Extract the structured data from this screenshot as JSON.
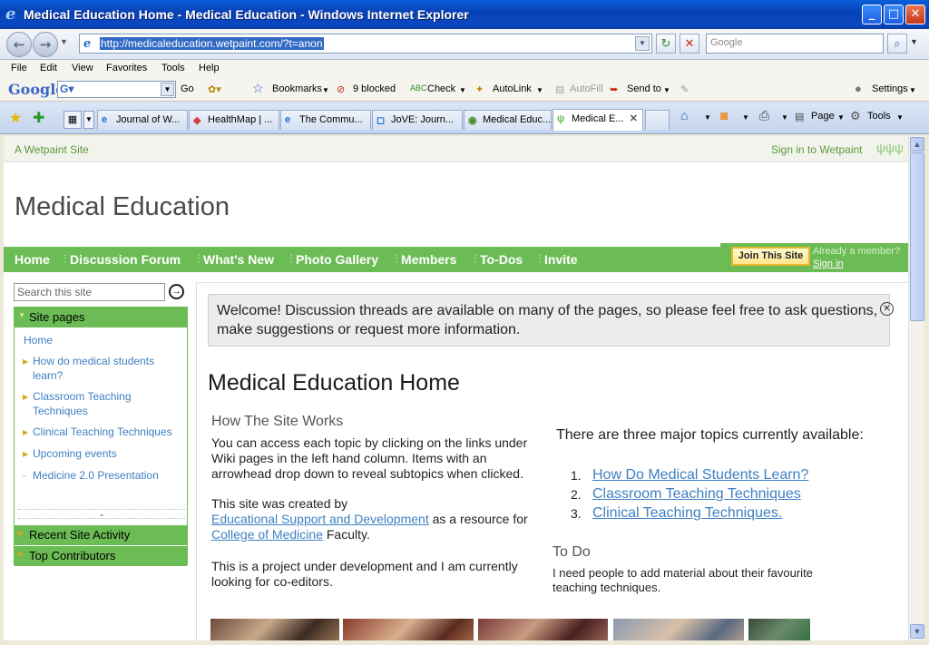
{
  "window": {
    "title": "Medical Education Home - Medical Education - Windows Internet Explorer"
  },
  "address": {
    "url": "http://medicaleducation.wetpaint.com/?t=anon",
    "search_placeholder": "Google"
  },
  "menu": [
    "File",
    "Edit",
    "View",
    "Favorites",
    "Tools",
    "Help"
  ],
  "google_toolbar": {
    "brand": "Google",
    "go": "Go",
    "bookmarks": "Bookmarks",
    "blocked": "9 blocked",
    "check": "Check",
    "autolink": "AutoLink",
    "autofill": "AutoFill",
    "sendto": "Send to",
    "settings": "Settings"
  },
  "tabs": [
    "Journal of W...",
    "HealthMap | ...",
    "The Commu...",
    "JoVE: Journ...",
    "Medical Educ...",
    "Medical E..."
  ],
  "tab_tools": {
    "page": "Page",
    "tools": "Tools"
  },
  "wetpaint": {
    "left": "A Wetpaint Site",
    "right": "Sign in to Wetpaint"
  },
  "site": {
    "title": "Medical Education"
  },
  "nav": [
    "Home",
    "Discussion Forum",
    "What's New",
    "Photo Gallery",
    "Members",
    "To-Dos",
    "Invite"
  ],
  "join": {
    "button": "Join This Site",
    "already": "Already a member?",
    "signin": "Sign in"
  },
  "sidebar": {
    "search_placeholder": "Search this site",
    "site_pages": "Site pages",
    "items": [
      {
        "label": "Home"
      },
      {
        "label": "How do medical students learn?"
      },
      {
        "label": "Classroom Teaching Techniques"
      },
      {
        "label": "Clinical Teaching Techniques"
      },
      {
        "label": "Upcoming events"
      },
      {
        "label": "Medicine 2.0 Presentation"
      }
    ],
    "recent": "Recent Site Activity",
    "contributors": "Top Contributors"
  },
  "main": {
    "welcome": "Welcome! Discussion threads are available on many of the pages, so please feel free to ask questions, make suggestions or request more information.",
    "heading": "Medical Education Home",
    "how_title": "How The Site Works",
    "how_text": "You can access each topic by clicking on the links under Wiki pages in the left hand column. Items with an arrowhead drop down to reveal subtopics when clicked.",
    "created_pre": "This site was created by",
    "created_link1": "Educational Support and Development",
    "created_mid": " as a resource for",
    "created_link2": "College of Medicine",
    "created_post": " Faculty.",
    "project": "This is a project under development and I am currently looking for co-editors.",
    "topics_intro": "There are three major topics currently available:",
    "topics": [
      {
        "num": "1.",
        "label": "How Do Medical Students Learn?"
      },
      {
        "num": "2.",
        "label": "Classroom Teaching Techniques"
      },
      {
        "num": "3.",
        "label": "Clinical Teaching Techniques."
      }
    ],
    "todo_title": "To Do",
    "todo_text": "I need people to add material about their favourite teaching techniques."
  },
  "colors": {
    "accent": "#6cbc56",
    "link": "#3f80c2",
    "ie_title": "#0842b6"
  }
}
